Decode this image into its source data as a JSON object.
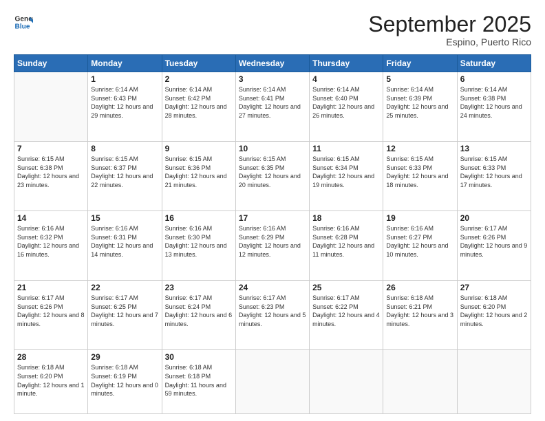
{
  "header": {
    "logo_line1": "General",
    "logo_line2": "Blue",
    "month": "September 2025",
    "location": "Espino, Puerto Rico"
  },
  "days_of_week": [
    "Sunday",
    "Monday",
    "Tuesday",
    "Wednesday",
    "Thursday",
    "Friday",
    "Saturday"
  ],
  "weeks": [
    [
      null,
      {
        "num": "1",
        "sunrise": "6:14 AM",
        "sunset": "6:43 PM",
        "daylight": "12 hours and 29 minutes."
      },
      {
        "num": "2",
        "sunrise": "6:14 AM",
        "sunset": "6:42 PM",
        "daylight": "12 hours and 28 minutes."
      },
      {
        "num": "3",
        "sunrise": "6:14 AM",
        "sunset": "6:41 PM",
        "daylight": "12 hours and 27 minutes."
      },
      {
        "num": "4",
        "sunrise": "6:14 AM",
        "sunset": "6:40 PM",
        "daylight": "12 hours and 26 minutes."
      },
      {
        "num": "5",
        "sunrise": "6:14 AM",
        "sunset": "6:39 PM",
        "daylight": "12 hours and 25 minutes."
      },
      {
        "num": "6",
        "sunrise": "6:14 AM",
        "sunset": "6:38 PM",
        "daylight": "12 hours and 24 minutes."
      }
    ],
    [
      {
        "num": "7",
        "sunrise": "6:15 AM",
        "sunset": "6:38 PM",
        "daylight": "12 hours and 23 minutes."
      },
      {
        "num": "8",
        "sunrise": "6:15 AM",
        "sunset": "6:37 PM",
        "daylight": "12 hours and 22 minutes."
      },
      {
        "num": "9",
        "sunrise": "6:15 AM",
        "sunset": "6:36 PM",
        "daylight": "12 hours and 21 minutes."
      },
      {
        "num": "10",
        "sunrise": "6:15 AM",
        "sunset": "6:35 PM",
        "daylight": "12 hours and 20 minutes."
      },
      {
        "num": "11",
        "sunrise": "6:15 AM",
        "sunset": "6:34 PM",
        "daylight": "12 hours and 19 minutes."
      },
      {
        "num": "12",
        "sunrise": "6:15 AM",
        "sunset": "6:33 PM",
        "daylight": "12 hours and 18 minutes."
      },
      {
        "num": "13",
        "sunrise": "6:15 AM",
        "sunset": "6:33 PM",
        "daylight": "12 hours and 17 minutes."
      }
    ],
    [
      {
        "num": "14",
        "sunrise": "6:16 AM",
        "sunset": "6:32 PM",
        "daylight": "12 hours and 16 minutes."
      },
      {
        "num": "15",
        "sunrise": "6:16 AM",
        "sunset": "6:31 PM",
        "daylight": "12 hours and 14 minutes."
      },
      {
        "num": "16",
        "sunrise": "6:16 AM",
        "sunset": "6:30 PM",
        "daylight": "12 hours and 13 minutes."
      },
      {
        "num": "17",
        "sunrise": "6:16 AM",
        "sunset": "6:29 PM",
        "daylight": "12 hours and 12 minutes."
      },
      {
        "num": "18",
        "sunrise": "6:16 AM",
        "sunset": "6:28 PM",
        "daylight": "12 hours and 11 minutes."
      },
      {
        "num": "19",
        "sunrise": "6:16 AM",
        "sunset": "6:27 PM",
        "daylight": "12 hours and 10 minutes."
      },
      {
        "num": "20",
        "sunrise": "6:17 AM",
        "sunset": "6:26 PM",
        "daylight": "12 hours and 9 minutes."
      }
    ],
    [
      {
        "num": "21",
        "sunrise": "6:17 AM",
        "sunset": "6:26 PM",
        "daylight": "12 hours and 8 minutes."
      },
      {
        "num": "22",
        "sunrise": "6:17 AM",
        "sunset": "6:25 PM",
        "daylight": "12 hours and 7 minutes."
      },
      {
        "num": "23",
        "sunrise": "6:17 AM",
        "sunset": "6:24 PM",
        "daylight": "12 hours and 6 minutes."
      },
      {
        "num": "24",
        "sunrise": "6:17 AM",
        "sunset": "6:23 PM",
        "daylight": "12 hours and 5 minutes."
      },
      {
        "num": "25",
        "sunrise": "6:17 AM",
        "sunset": "6:22 PM",
        "daylight": "12 hours and 4 minutes."
      },
      {
        "num": "26",
        "sunrise": "6:18 AM",
        "sunset": "6:21 PM",
        "daylight": "12 hours and 3 minutes."
      },
      {
        "num": "27",
        "sunrise": "6:18 AM",
        "sunset": "6:20 PM",
        "daylight": "12 hours and 2 minutes."
      }
    ],
    [
      {
        "num": "28",
        "sunrise": "6:18 AM",
        "sunset": "6:20 PM",
        "daylight": "12 hours and 1 minute."
      },
      {
        "num": "29",
        "sunrise": "6:18 AM",
        "sunset": "6:19 PM",
        "daylight": "12 hours and 0 minutes."
      },
      {
        "num": "30",
        "sunrise": "6:18 AM",
        "sunset": "6:18 PM",
        "daylight": "11 hours and 59 minutes."
      },
      null,
      null,
      null,
      null
    ]
  ],
  "labels": {
    "sunrise_prefix": "Sunrise: ",
    "sunset_prefix": "Sunset: ",
    "daylight_prefix": "Daylight: "
  }
}
